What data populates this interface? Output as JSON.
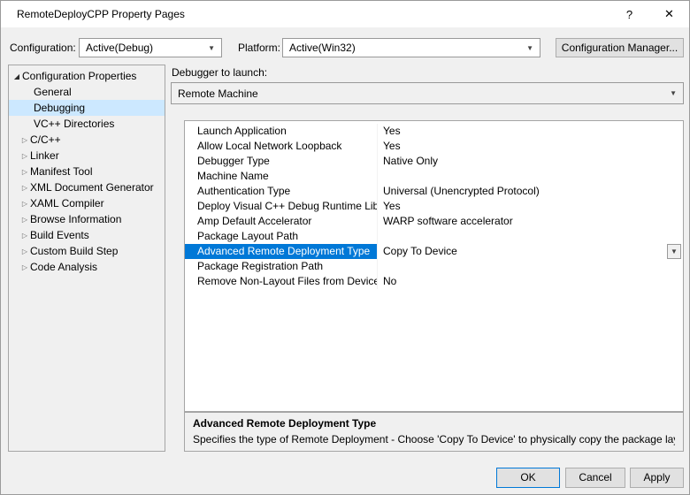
{
  "window": {
    "title": "RemoteDeployCPP Property Pages"
  },
  "icons": {
    "help": "?",
    "close": "✕",
    "chevron_down": "▼",
    "tree_expanded": "◢",
    "tree_collapsed": "▷"
  },
  "toolbar": {
    "configuration_label": "Configuration:",
    "configuration_value": "Active(Debug)",
    "platform_label": "Platform:",
    "platform_value": "Active(Win32)",
    "config_manager_label": "Configuration Manager..."
  },
  "tree": {
    "root_label": "Configuration Properties",
    "items": [
      {
        "label": "General"
      },
      {
        "label": "Debugging"
      },
      {
        "label": "VC++ Directories"
      },
      {
        "label": "C/C++"
      },
      {
        "label": "Linker"
      },
      {
        "label": "Manifest Tool"
      },
      {
        "label": "XML Document Generator"
      },
      {
        "label": "XAML Compiler"
      },
      {
        "label": "Browse Information"
      },
      {
        "label": "Build Events"
      },
      {
        "label": "Custom Build Step"
      },
      {
        "label": "Code Analysis"
      }
    ]
  },
  "debugger": {
    "label": "Debugger to launch:",
    "value": "Remote Machine"
  },
  "property_grid": {
    "rows": [
      {
        "name": "Launch Application",
        "value": "Yes"
      },
      {
        "name": "Allow Local Network Loopback",
        "value": "Yes"
      },
      {
        "name": "Debugger Type",
        "value": "Native Only"
      },
      {
        "name": "Machine Name",
        "value": ""
      },
      {
        "name": "Authentication Type",
        "value": "Universal (Unencrypted Protocol)"
      },
      {
        "name": "Deploy Visual C++ Debug Runtime Librari",
        "value": "Yes"
      },
      {
        "name": "Amp Default Accelerator",
        "value": "WARP software accelerator"
      },
      {
        "name": "Package Layout Path",
        "value": ""
      },
      {
        "name": "Advanced Remote Deployment Type",
        "value": "Copy To Device"
      },
      {
        "name": "Package Registration Path",
        "value": ""
      },
      {
        "name": "Remove Non-Layout Files from Device",
        "value": "No"
      }
    ]
  },
  "description": {
    "title": "Advanced Remote Deployment Type",
    "text": "Specifies the type of Remote Deployment - Choose 'Copy To Device' to physically copy the package layout to re..."
  },
  "footer": {
    "ok_label": "OK",
    "cancel_label": "Cancel",
    "apply_label": "Apply"
  },
  "colors": {
    "accent": "#0078d7",
    "grid_selection": "#0078d7",
    "tree_selection": "#cce8ff",
    "dialog_background": "#f0f0f0"
  }
}
